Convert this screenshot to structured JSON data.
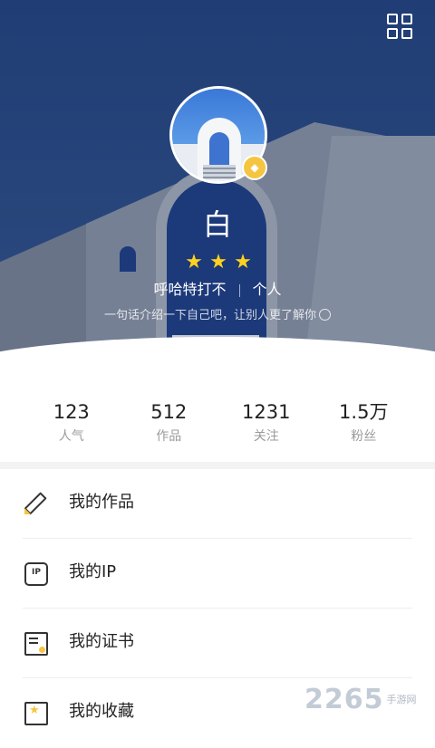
{
  "header": {
    "nickname": "白",
    "stars": 3,
    "star_glyph": "★",
    "name": "呼哈特打不",
    "account_type": "个人",
    "bio": "一句话介绍一下自己吧，让别人更了解你",
    "icons": [
      "qr-code-icon",
      "vip-diamond-icon",
      "edit-icon"
    ],
    "badge_glyph": "◆"
  },
  "stats": [
    {
      "value": "123",
      "label": "人气"
    },
    {
      "value": "512",
      "label": "作品"
    },
    {
      "value": "1231",
      "label": "关注"
    },
    {
      "value": "1.5万",
      "label": "粉丝"
    }
  ],
  "menu": [
    {
      "label": "我的作品",
      "icon": "pencil-ruler-icon"
    },
    {
      "label": "我的IP",
      "icon": "ip-hexagon-icon",
      "icon_text": "IP"
    },
    {
      "label": "我的证书",
      "icon": "certificate-icon"
    },
    {
      "label": "我的收藏",
      "icon": "favorite-icon"
    }
  ],
  "watermark": {
    "logo": "2265",
    "site": "手游网"
  },
  "colors": {
    "accent": "#ffd21f",
    "header_bg": "#2b4d86",
    "text_dark": "#222222",
    "text_muted": "#9b9b9b"
  }
}
